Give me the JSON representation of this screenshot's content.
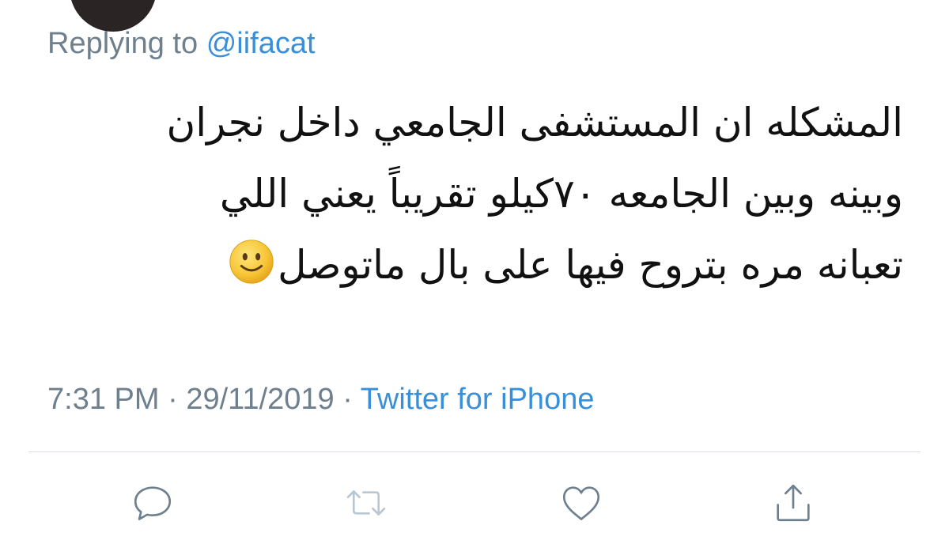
{
  "reply_context": {
    "prefix": "Replying to",
    "handle": "@iifacat"
  },
  "tweet": {
    "lines": [
      "المشكله ان المستشفى الجامعي داخل نجران",
      "وبينه وبين الجامعه ٧٠كيلو تقريباً يعني اللي",
      "تعبانه مره بتروح فيها على بال ماتوصل"
    ],
    "emoji": "slightly-smiling-face"
  },
  "meta": {
    "time": "7:31 PM",
    "separator": "·",
    "date": "29/11/2019",
    "source": "Twitter for iPhone"
  },
  "colors": {
    "link": "#3a8fd9",
    "muted": "#6e7f8d",
    "disabled_icon": "#b9c7d2",
    "divider": "#d7dde2"
  },
  "actions": [
    {
      "name": "reply",
      "icon": "speech-bubble-icon"
    },
    {
      "name": "retweet",
      "icon": "retweet-icon",
      "disabled": true
    },
    {
      "name": "like",
      "icon": "heart-icon"
    },
    {
      "name": "share",
      "icon": "share-icon"
    }
  ]
}
